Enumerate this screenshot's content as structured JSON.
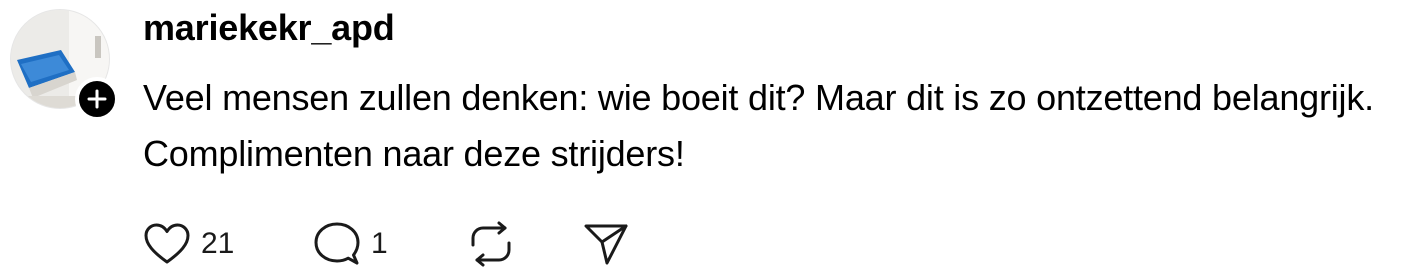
{
  "comment": {
    "username": "mariekekr_apd",
    "text": "Veel mensen zullen denken: wie boeit dit? Maar dit is zo ontzettend belangrijk. Complimenten naar deze strijders!",
    "avatar_icon": "profile-photo-pool",
    "follow_icon": "plus-icon"
  },
  "actions": {
    "like_count": "21",
    "reply_count": "1",
    "like_icon": "heart-icon",
    "reply_icon": "speech-bubble-icon",
    "repost_icon": "repost-icon",
    "share_icon": "send-icon"
  },
  "colors": {
    "text": "#000000",
    "badge": "#000000",
    "background": "#ffffff"
  }
}
